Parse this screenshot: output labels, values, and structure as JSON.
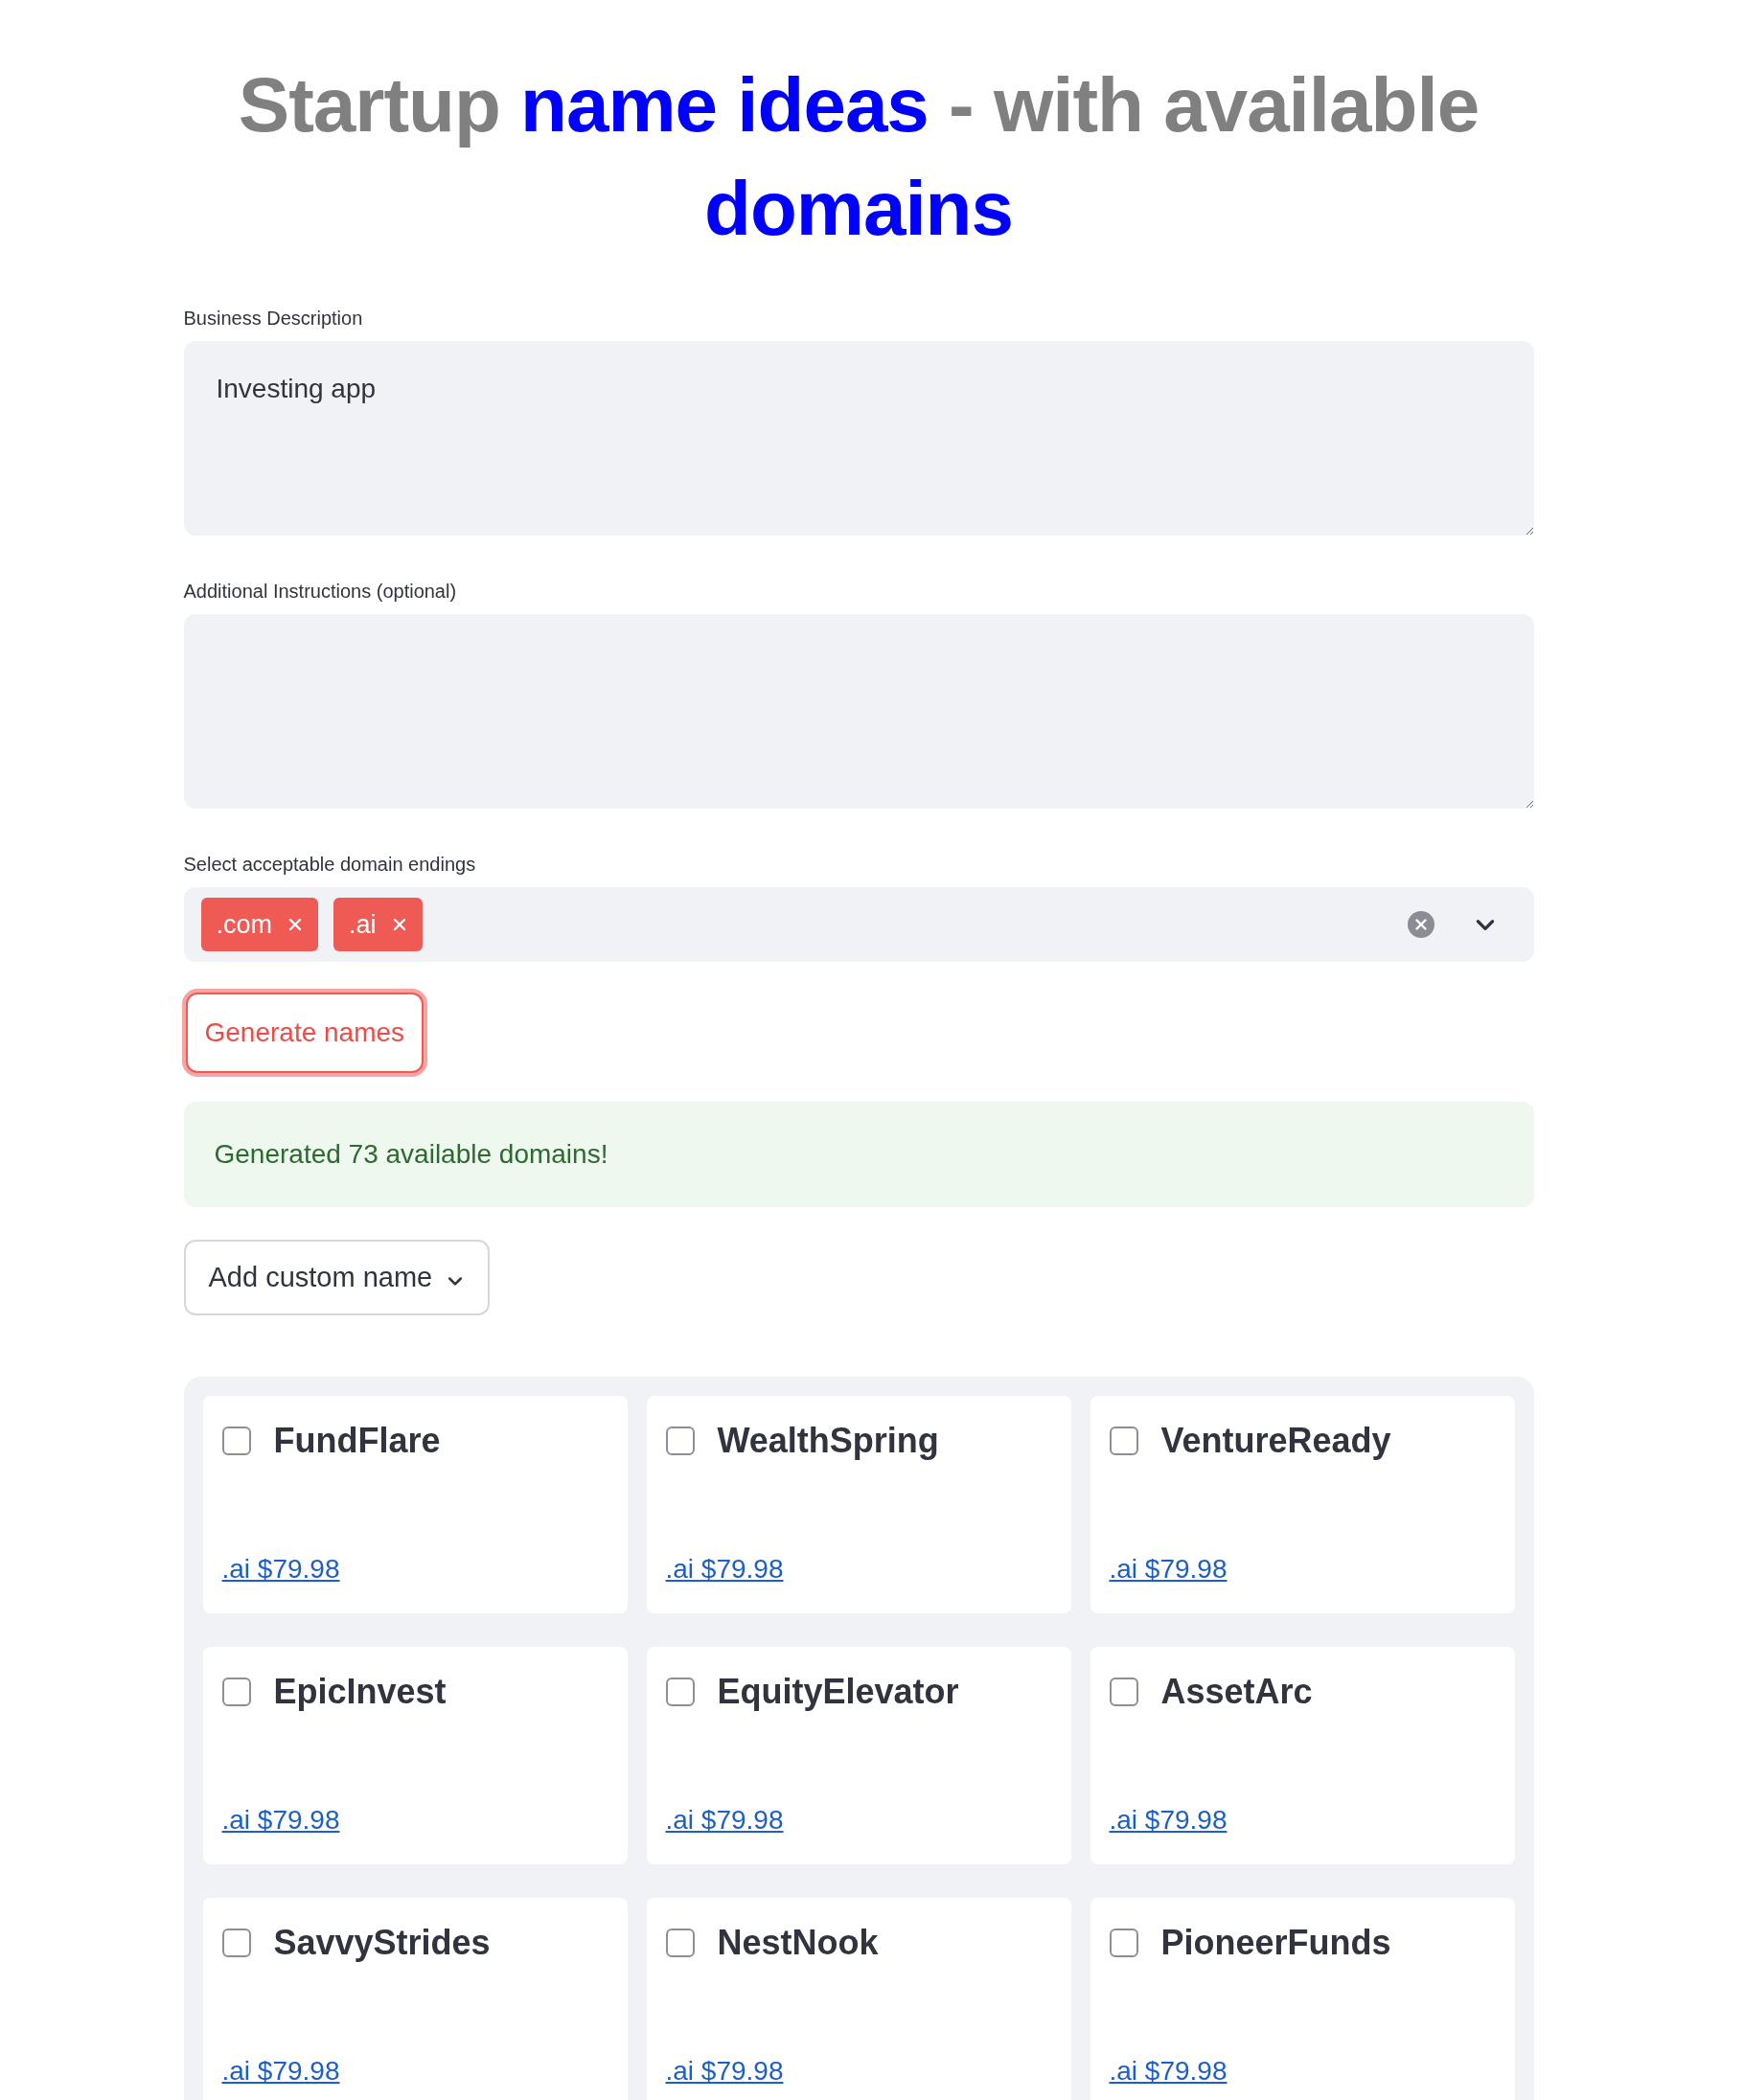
{
  "title": [
    {
      "text": "Startup ",
      "highlight": false
    },
    {
      "text": "name ideas",
      "highlight": true
    },
    {
      "text": " - with available ",
      "highlight": false
    },
    {
      "text": "domains",
      "highlight": true
    }
  ],
  "description": {
    "label": "Business Description",
    "value": "Investing app"
  },
  "instructions": {
    "label": "Additional Instructions (optional)"
  },
  "endings": {
    "label": "Select acceptable domain endings",
    "tags": [
      ".com",
      ".ai"
    ]
  },
  "generate_button": "Generate names",
  "success": "Generated 73 available domains!",
  "expander": {
    "label": "Add custom name",
    "expanded": false
  },
  "names": [
    {
      "name": "FundFlare",
      "checked": false,
      "link": ".ai $79.98"
    },
    {
      "name": "WealthSpring",
      "checked": false,
      "link": ".ai $79.98"
    },
    {
      "name": "VentureReady",
      "checked": false,
      "link": ".ai $79.98"
    },
    {
      "name": "EpicInvest",
      "checked": false,
      "link": ".ai $79.98"
    },
    {
      "name": "EquityElevator",
      "checked": false,
      "link": ".ai $79.98"
    },
    {
      "name": "AssetArc",
      "checked": false,
      "link": ".ai $79.98"
    },
    {
      "name": "SavvyStrides",
      "checked": false,
      "link": ".ai $79.98"
    },
    {
      "name": "NestNook",
      "checked": false,
      "link": ".ai $79.98"
    },
    {
      "name": "PioneerFunds",
      "checked": false,
      "link": ".ai $79.98"
    }
  ]
}
